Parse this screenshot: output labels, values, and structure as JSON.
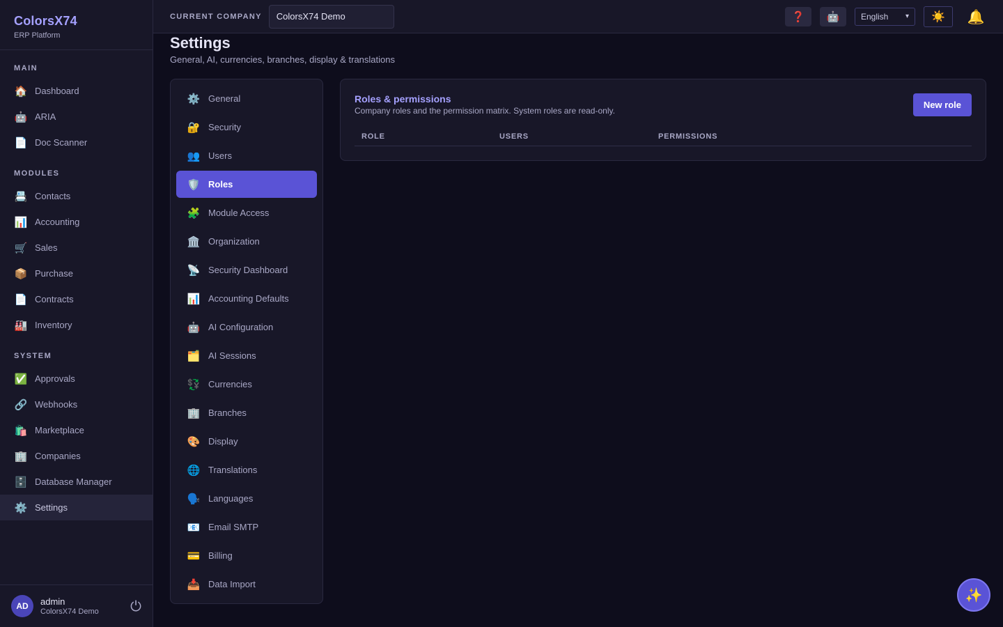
{
  "brand": {
    "title": "ColorsX74",
    "subtitle": "ERP Platform"
  },
  "sidebar": {
    "sections": [
      {
        "label": "MAIN",
        "items": [
          {
            "label": "Dashboard",
            "icon": "🏠"
          },
          {
            "label": "ARIA",
            "icon": "🤖"
          },
          {
            "label": "Doc Scanner",
            "icon": "📄"
          }
        ]
      },
      {
        "label": "MODULES",
        "items": [
          {
            "label": "Contacts",
            "icon": "📇"
          },
          {
            "label": "Accounting",
            "icon": "📊"
          },
          {
            "label": "Sales",
            "icon": "🛒"
          },
          {
            "label": "Purchase",
            "icon": "📦"
          },
          {
            "label": "Contracts",
            "icon": "📄"
          },
          {
            "label": "Inventory",
            "icon": "🏭"
          }
        ]
      },
      {
        "label": "SYSTEM",
        "items": [
          {
            "label": "Approvals",
            "icon": "✅"
          },
          {
            "label": "Webhooks",
            "icon": "🔗"
          },
          {
            "label": "Marketplace",
            "icon": "🛍️"
          },
          {
            "label": "Companies",
            "icon": "🏢"
          },
          {
            "label": "Database Manager",
            "icon": "🗄️"
          },
          {
            "label": "Settings",
            "icon": "⚙️",
            "active": true
          }
        ]
      }
    ]
  },
  "user": {
    "initials": "AD",
    "name": "admin",
    "company": "ColorsX74 Demo",
    "logout_icon": "⏻"
  },
  "topbar": {
    "company_label": "CURRENT COMPANY",
    "company_value": "ColorsX74 Demo",
    "help_icon": "❓",
    "bot_icon": "🤖",
    "language": "English",
    "theme_icon": "☀️",
    "bell_icon": "🔔"
  },
  "page": {
    "title": "Settings",
    "subtitle": "General, AI, currencies, branches, display & translations"
  },
  "settings_nav": [
    {
      "label": "General",
      "icon": "⚙️"
    },
    {
      "label": "Security",
      "icon": "🔐"
    },
    {
      "label": "Users",
      "icon": "👥"
    },
    {
      "label": "Roles",
      "icon": "🛡️",
      "active": true
    },
    {
      "label": "Module Access",
      "icon": "🧩"
    },
    {
      "label": "Organization",
      "icon": "🏛️"
    },
    {
      "label": "Security Dashboard",
      "icon": "📡"
    },
    {
      "label": "Accounting Defaults",
      "icon": "📊"
    },
    {
      "label": "AI Configuration",
      "icon": "🤖"
    },
    {
      "label": "AI Sessions",
      "icon": "🗂️"
    },
    {
      "label": "Currencies",
      "icon": "💱"
    },
    {
      "label": "Branches",
      "icon": "🏢"
    },
    {
      "label": "Display",
      "icon": "🎨"
    },
    {
      "label": "Translations",
      "icon": "🌐"
    },
    {
      "label": "Languages",
      "icon": "🗣️"
    },
    {
      "label": "Email SMTP",
      "icon": "📧"
    },
    {
      "label": "Billing",
      "icon": "💳"
    },
    {
      "label": "Data Import",
      "icon": "📥"
    }
  ],
  "roles_card": {
    "title": "Roles & permissions",
    "subtitle": "Company roles and the permission matrix. System roles are read-only.",
    "new_button": "New role",
    "columns": [
      "ROLE",
      "USERS",
      "PERMISSIONS"
    ]
  },
  "fab_icon": "✨",
  "colors": {
    "accent": "#5a53d6",
    "brand": "#a5a1ff",
    "bg": "#0e0d1c",
    "panel": "#181728"
  }
}
